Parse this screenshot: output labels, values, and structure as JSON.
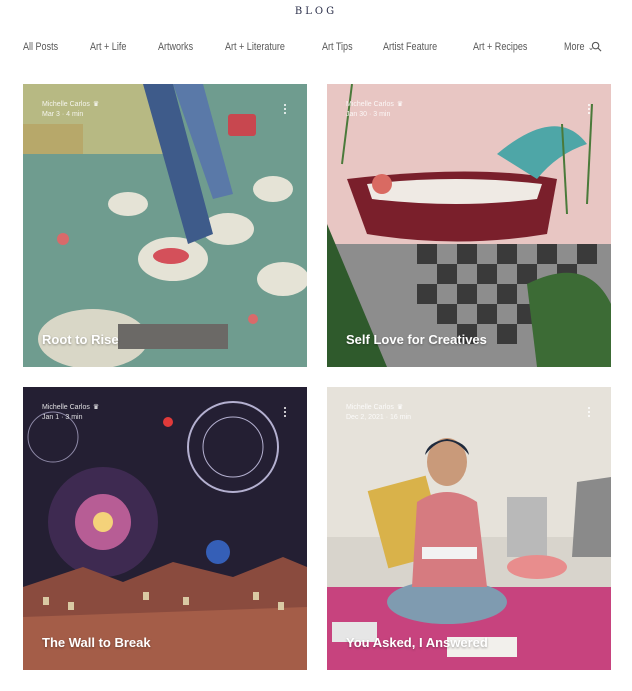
{
  "brand": {
    "title": "BLOG"
  },
  "nav": {
    "items": [
      "All Posts",
      "Art + Life",
      "Artworks",
      "Art + Literature",
      "Art Tips",
      "Artist Feature",
      "Art + Recipes"
    ],
    "more_label": "More",
    "search_icon": "search-icon"
  },
  "posts": [
    {
      "title": "Root to Rise",
      "author": "Michelle Carlos",
      "date": "Mar 3",
      "read_time": "4 min",
      "theme": "teal"
    },
    {
      "title": "Self Love for Creatives",
      "author": "Michelle Carlos",
      "date": "Jan 30",
      "read_time": "3 min",
      "theme": "pink"
    },
    {
      "title": "The Wall to Break",
      "author": "Michelle Carlos",
      "date": "Jan 1",
      "read_time": "3 min",
      "theme": "purple"
    },
    {
      "title": "You Asked, I Answered",
      "author": "Michelle Carlos",
      "date": "Dec 2, 2021",
      "read_time": "16 min",
      "theme": "photo"
    }
  ]
}
